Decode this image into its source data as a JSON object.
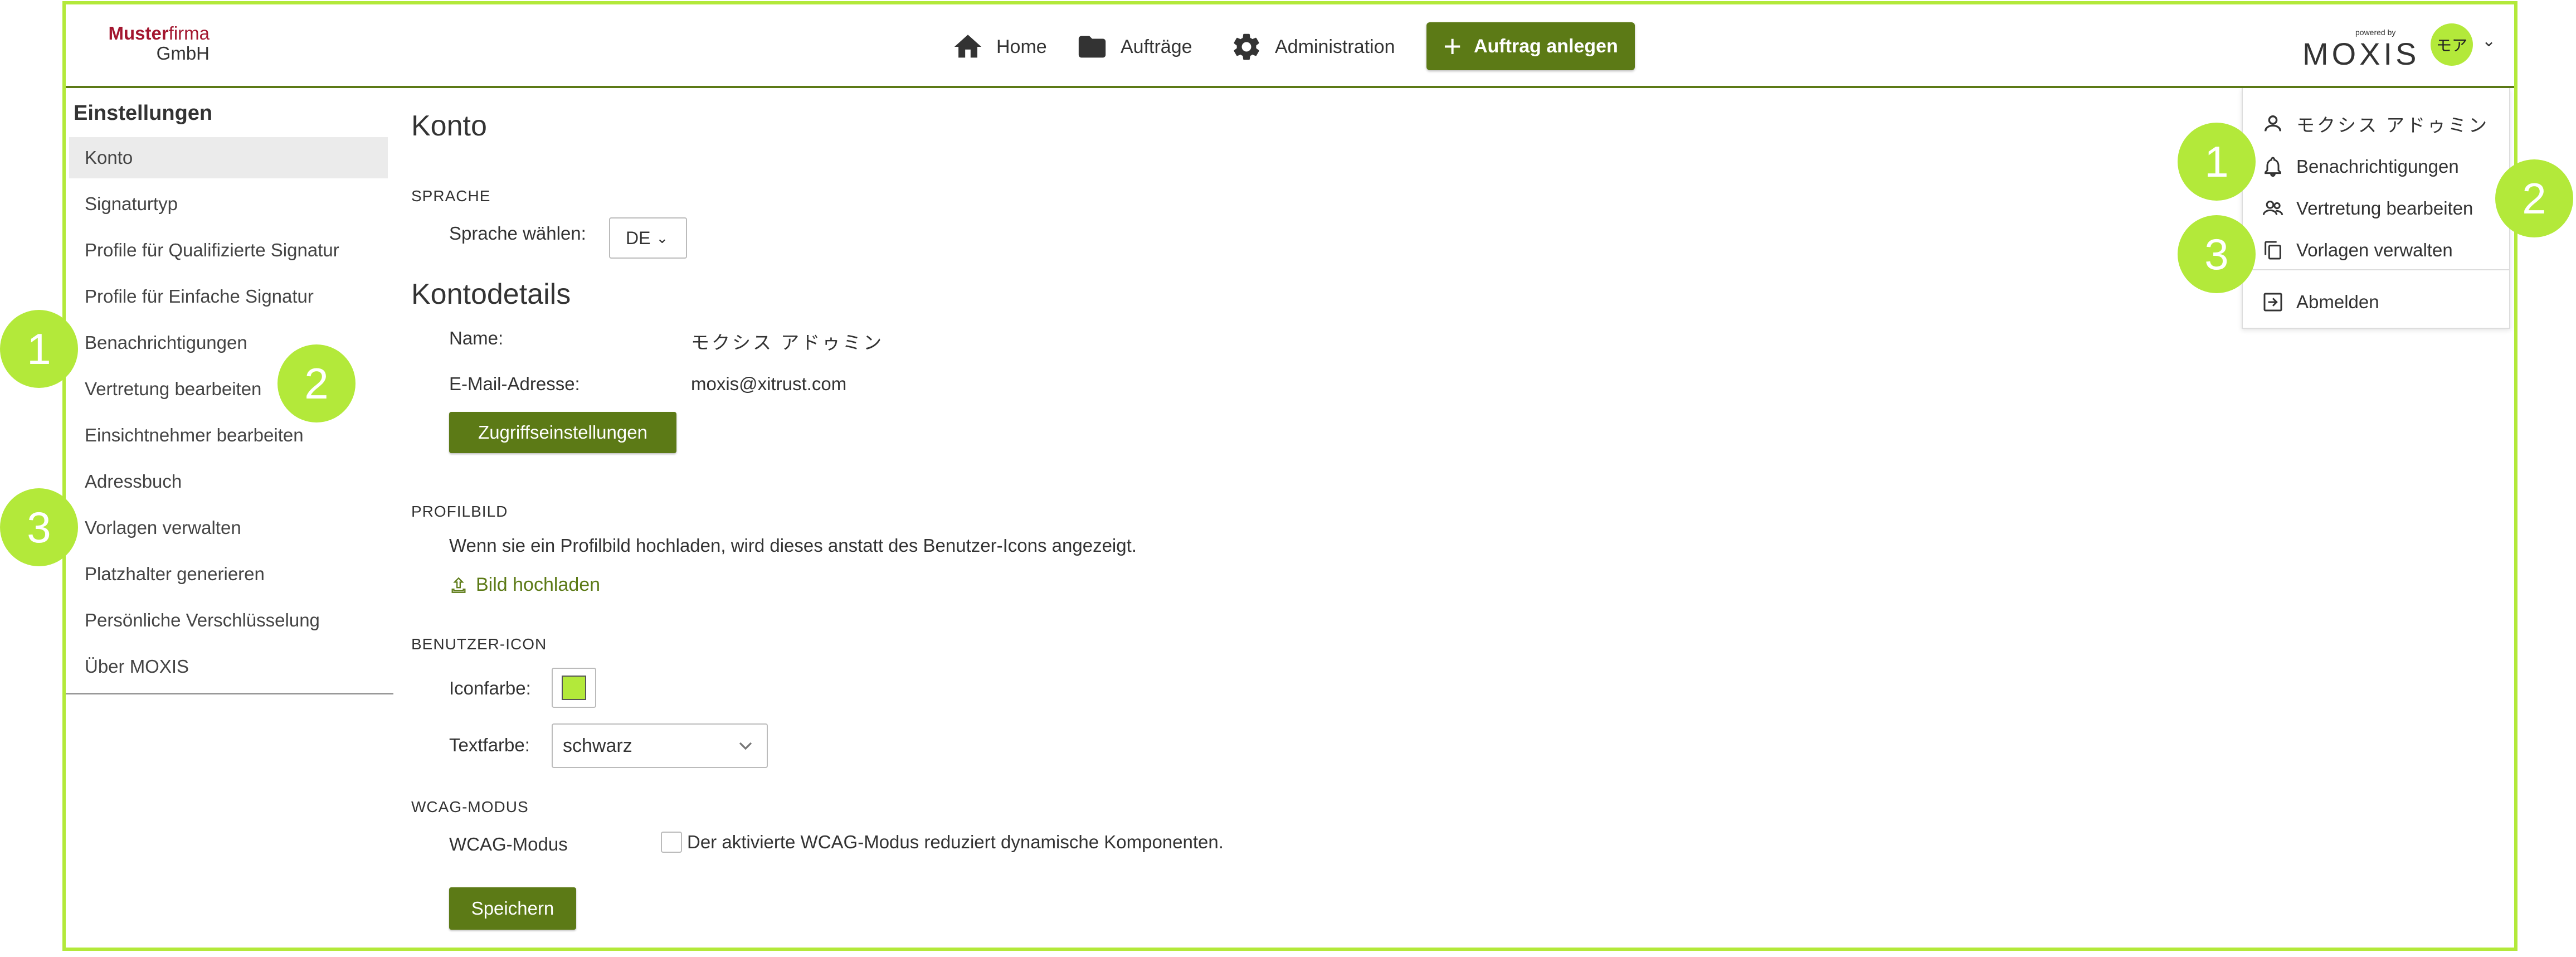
{
  "header": {
    "logo": {
      "line1_a": "Muster",
      "line1_b": "firma",
      "line2": "GmbH"
    },
    "nav": [
      {
        "label": "Home",
        "icon": "home-icon"
      },
      {
        "label": "Aufträge",
        "icon": "folder-icon"
      },
      {
        "label": "Administration",
        "icon": "gear-icon"
      }
    ],
    "create_button": "Auftrag anlegen",
    "brand": {
      "powered": "powered by",
      "name": "MOXIS"
    },
    "avatar_initials": "モア"
  },
  "sidebar": {
    "title": "Einstellungen",
    "items": [
      {
        "label": "Konto"
      },
      {
        "label": "Signaturtyp"
      },
      {
        "label": "Profile für Qualifizierte Signatur"
      },
      {
        "label": "Profile für Einfache Signatur"
      },
      {
        "label": "Benachrichtigungen"
      },
      {
        "label": "Vertretung bearbeiten"
      },
      {
        "label": "Einsichtnehmer bearbeiten"
      },
      {
        "label": "Adressbuch"
      },
      {
        "label": "Vorlagen verwalten"
      },
      {
        "label": "Platzhalter generieren"
      },
      {
        "label": "Persönliche Verschlüsselung"
      },
      {
        "label": "Über MOXIS"
      }
    ]
  },
  "main": {
    "title": "Konto",
    "language": {
      "section": "SPRACHE",
      "label": "Sprache wählen:",
      "value": "DE"
    },
    "account_details": {
      "title": "Kontodetails",
      "name_label": "Name:",
      "name_value": "モクシス アドゥミン",
      "email_label": "E-Mail-Adresse:",
      "email_value": "moxis@xitrust.com",
      "access_button": "Zugriffseinstellungen"
    },
    "profile_picture": {
      "section": "PROFILBILD",
      "description": "Wenn sie ein Profilbild hochladen, wird dieses anstatt des Benutzer-Icons angezeigt.",
      "upload_link": "Bild hochladen"
    },
    "user_icon": {
      "section": "BENUTZER-ICON",
      "icon_color_label": "Iconfarbe:",
      "icon_color": "#b3e93a",
      "text_color_label": "Textfarbe:",
      "text_color_value": "schwarz"
    },
    "wcag": {
      "section": "WCAG-MODUS",
      "label": "WCAG-Modus",
      "checkbox_text": "Der aktivierte WCAG-Modus reduziert dynamische Komponenten."
    },
    "save_button": "Speichern"
  },
  "user_menu": {
    "items": [
      {
        "label": "モクシス アドゥミン",
        "icon": "user-icon"
      },
      {
        "label": "Benachrichtigungen",
        "icon": "bell-icon"
      },
      {
        "label": "Vertretung bearbeiten",
        "icon": "users-icon"
      },
      {
        "label": "Vorlagen verwalten",
        "icon": "copy-icon"
      },
      {
        "label": "Abmelden",
        "icon": "logout-icon"
      }
    ]
  },
  "callouts": [
    "1",
    "2",
    "3",
    "1",
    "2",
    "3"
  ],
  "colors": {
    "accent": "#5c7a16",
    "highlight": "#b3e93a",
    "brand_red": "#a3162f"
  }
}
